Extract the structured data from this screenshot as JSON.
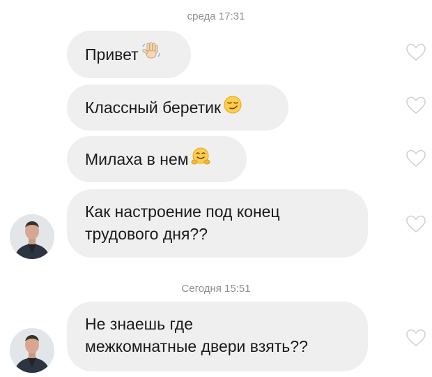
{
  "conversation": {
    "groups": [
      {
        "timestamp": "среда 17:31",
        "messages": [
          {
            "text": "Привет",
            "emoji": "waving-hand"
          },
          {
            "text": "Классный беретик",
            "emoji": "smirking-face"
          },
          {
            "text": "Милаха в нем",
            "emoji": "hugging-face"
          },
          {
            "line1": "Как настроение под конец",
            "line2": "трудового дня??"
          }
        ]
      },
      {
        "timestamp": "Сегодня 15:51",
        "messages": [
          {
            "line1": "Не знаешь где",
            "line2": "межкомнатные двери взять??"
          }
        ]
      }
    ]
  },
  "colors": {
    "bubble": "#efefef",
    "timestamp": "#8e8e8e",
    "heart_outline": "#d0d0d0"
  }
}
